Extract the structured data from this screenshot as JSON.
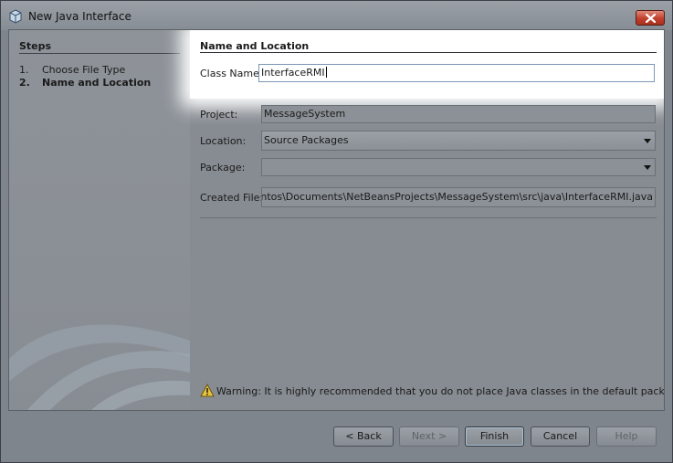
{
  "window": {
    "title": "New Java Interface"
  },
  "steps": {
    "title": "Steps",
    "items": [
      {
        "num": "1.",
        "label": "Choose File Type",
        "current": false
      },
      {
        "num": "2.",
        "label": "Name and Location",
        "current": true
      }
    ]
  },
  "form": {
    "section_title": "Name and Location",
    "class_name": {
      "label": "Class Name:",
      "value": "InterfaceRMI"
    },
    "project": {
      "label": "Project:",
      "value": "MessageSystem"
    },
    "location": {
      "label": "Location:",
      "value": "Source Packages"
    },
    "package": {
      "label": "Package:",
      "value": ""
    },
    "created_file": {
      "label": "Created File:",
      "value": "Daniel Santos\\Documents\\NetBeansProjects\\MessageSystem\\src\\java\\InterfaceRMI.java"
    }
  },
  "warning": {
    "text": "Warning: It is highly recommended that you do not place Java classes in the default package."
  },
  "buttons": {
    "back": "< Back",
    "next": "Next >",
    "finish": "Finish",
    "cancel": "Cancel",
    "help": "Help"
  }
}
